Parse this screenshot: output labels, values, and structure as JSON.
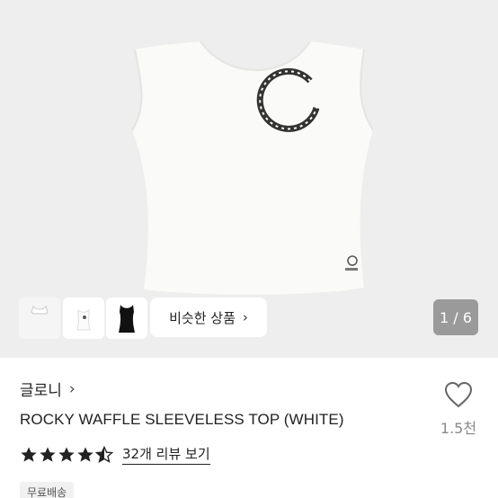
{
  "gallery": {
    "thumbnails": [
      "top-front-thumbnail",
      "top-detail-thumbnail",
      "black-top-thumbnail"
    ],
    "similar_button": {
      "label": "비슷한 상품",
      "icon": "chevron-right-icon"
    },
    "page_indicator": "1 / 6"
  },
  "product": {
    "shop_name": "글로니",
    "title": "ROCKY WAFFLE SLEEVELESS TOP (WHITE)",
    "likes": "1.5천",
    "rating": 4.5,
    "review_link": "32개 리뷰 보기",
    "shipping_badge": "무료배송"
  },
  "colors": {
    "gallery_bg": "#eeeeee",
    "badge_bg": "#9a9a9a",
    "text": "#222222",
    "muted": "#888888"
  }
}
